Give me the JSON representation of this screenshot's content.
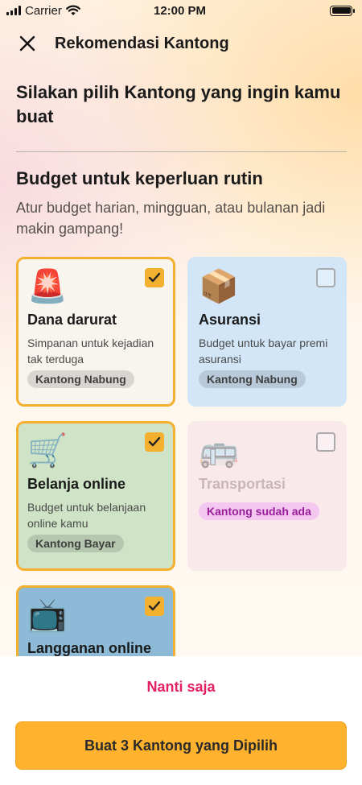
{
  "status": {
    "carrier": "Carrier",
    "time": "12:00 PM"
  },
  "header": {
    "title": "Rekomendasi Kantong"
  },
  "intro": "Silakan pilih Kantong yang ingin kamu buat",
  "section": {
    "title": "Budget untuk keperluan rutin",
    "subtitle": "Atur budget harian, mingguan, atau bulanan jadi makin gampang!"
  },
  "cards": [
    {
      "icon": "🚨",
      "icon_name": "siren-icon",
      "title": "Dana darurat",
      "desc": "Simpanan untuk kejadian tak terduga",
      "badge": "Kantong Nabung",
      "checked": true,
      "color": "#f8f4ee"
    },
    {
      "icon": "📦",
      "icon_name": "package-icon",
      "title": "Asuransi",
      "desc": "Budget untuk bayar premi asuransi",
      "badge": "Kantong Nabung",
      "checked": false,
      "color": "#d2e6f8"
    },
    {
      "icon": "🛒",
      "icon_name": "shopping-cart-icon",
      "title": "Belanja online",
      "desc": "Budget untuk belanjaan online kamu",
      "badge": "Kantong Bayar",
      "checked": true,
      "color": "#cfe3c6"
    },
    {
      "icon": "🚌",
      "icon_name": "minibus-icon",
      "title": "Transportasi",
      "desc": "",
      "badge": "Kantong sudah ada",
      "checked": false,
      "color": "#f9e9ea"
    },
    {
      "icon": "📺",
      "icon_name": "television-icon",
      "title": "Langganan online",
      "desc": "",
      "badge": "",
      "checked": true,
      "color": "#8dbad6"
    }
  ],
  "actions": {
    "later": "Nanti saja",
    "create": "Buat 3 Kantong yang Dipilih"
  },
  "colors": {
    "accent": "#ffb22e",
    "link": "#e41f63"
  }
}
